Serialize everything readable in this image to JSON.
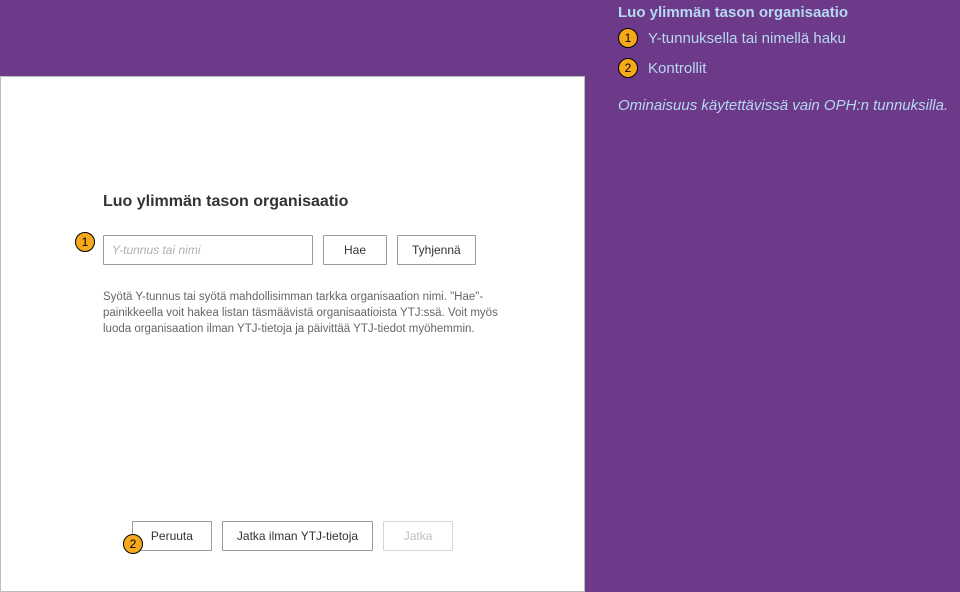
{
  "doc_title": "Luo ylimmän tason organisaatio",
  "legend": {
    "items": [
      {
        "num": "1",
        "label": "Y-tunnuksella tai nimellä haku"
      },
      {
        "num": "2",
        "label": "Kontrollit"
      }
    ]
  },
  "note": "Ominaisuus käytettävissä vain OPH:n tunnuksilla.",
  "panel": {
    "title": "Luo ylimmän tason organisaatio",
    "search": {
      "placeholder": "Y-tunnus tai nimi",
      "value": "",
      "hae": "Hae",
      "tyhjenna": "Tyhjennä"
    },
    "help": "Syötä Y-tunnus tai syötä mahdollisimman tarkka organisaation nimi. \"Hae\"-painikkeella voit hakea listan täsmäävistä organisaatioista YTJ:ssä. Voit myös luoda organisaation ilman YTJ-tietoja ja päivittää YTJ-tiedot myöhemmin.",
    "buttons": {
      "peruuta": "Peruuta",
      "ilman": "Jatka ilman YTJ-tietoja",
      "jatka": "Jatka"
    }
  },
  "callouts": {
    "c1": "1",
    "c2": "2"
  }
}
